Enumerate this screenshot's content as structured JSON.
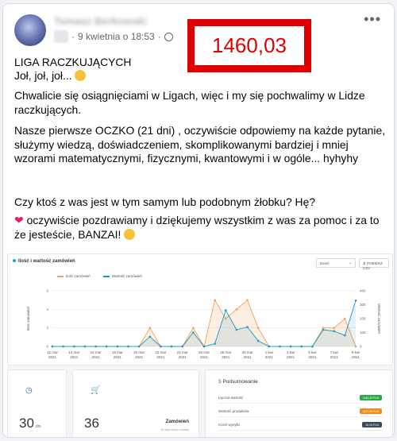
{
  "post": {
    "author": "Tomasz Berkowski",
    "timestamp": "9 kwietnia o 18:53",
    "more_label": "•••",
    "highlight_number": "1460,03",
    "title_line": "LIGA RACZKUJĄCYCH",
    "line2": "Joł, joł, joł...",
    "paragraph1": "Chwalicie się osiągnięciami w Ligach, więc i my się pochwalimy w Lidze raczkujących.",
    "paragraph2": "Nasze pierwsze OCZKO (21 dni) , oczywiście odpowiemy na każde pytanie, służymy wiedzą, doświadczeniem, skomplikowanymi bardziej i mniej wzorami matematycznymi, fizycznymi, kwantowymi i w ogóle... hyhyhy",
    "paragraph3": "Czy ktoś z was jest w tym samym lub podobnym żłobku? Hę?",
    "paragraph4": "oczywiście pozdrawiamy i dziękujemy wszystkim z was za pomoc i za to że jesteście, BANZAI!"
  },
  "dashboard": {
    "chart_title": "Ilość i wartość zamówień",
    "range_select": "Dzień",
    "download_label": "POBIERZ CSV",
    "legend": [
      "Ilość zamówień",
      "Wartość zamówień"
    ],
    "colors": {
      "orders": "#f0a35a",
      "value": "#1e98c8"
    },
    "stat1": {
      "value": "30",
      "unit": "dni"
    },
    "stat2": {
      "value": "36",
      "label": "Zamówień",
      "sub": "W wybranym czasie"
    },
    "summary": {
      "title": "Podsumowanie",
      "rows": [
        {
          "label": "Łączna wartość",
          "value": "1460,03 PLN",
          "color": "#2ba84a"
        },
        {
          "label": "Wartość produktów",
          "value": "1427,99 PLN",
          "color": "#f08b1e"
        },
        {
          "label": "Koszt wysyłki",
          "value": "32,04 PLN",
          "color": "#3b4a5a"
        }
      ]
    }
  },
  "chart_data": {
    "type": "area",
    "title": "Ilość i wartość zamówień",
    "ylabel": "Ilość zamówień",
    "y2label": "Wartość zamówień",
    "ylim": [
      0,
      6
    ],
    "y2lim": [
      0,
      400
    ],
    "x": [
      "12 mar 2021",
      "13 mar",
      "14 mar 2021",
      "15 mar",
      "16 mar 2021",
      "17 mar",
      "18 mar 2021",
      "19 mar",
      "20 mar 2021",
      "21 mar",
      "22 mar 2021",
      "23 mar",
      "24 mar 2021",
      "25 mar",
      "26 mar 2021",
      "27 mar",
      "28 mar 2021",
      "29 mar",
      "30 mar 2021",
      "31 mar",
      "1 kwi 2021",
      "2 kwi",
      "3 kwi 2021",
      "4 kwi",
      "5 kwi 2021",
      "6 kwi",
      "7 kwi 2021",
      "8 kwi",
      "9 kwi 2021"
    ],
    "tick_labels": [
      [
        "12 mar",
        "2021"
      ],
      [
        "14 mar",
        "2021"
      ],
      [
        "16 mar",
        "2021"
      ],
      [
        "18 mar",
        "2021"
      ],
      [
        "20 mar",
        "2021"
      ],
      [
        "22 mar",
        "2021"
      ],
      [
        "24 mar",
        "2021"
      ],
      [
        "26 mar",
        "2021"
      ],
      [
        "28 mar",
        "2021"
      ],
      [
        "30 mar",
        "2021"
      ],
      [
        "1 kwi",
        "2021"
      ],
      [
        "3 kwi",
        "2021"
      ],
      [
        "5 kwi",
        "2021"
      ],
      [
        "7 kwi",
        "2021"
      ],
      [
        "9 kwi",
        "2021"
      ]
    ],
    "series": [
      {
        "name": "Ilość zamówień",
        "axis": "left",
        "values": [
          0,
          0,
          0,
          0,
          0,
          0,
          0,
          0,
          0,
          2,
          0,
          0,
          0,
          2,
          0,
          5,
          3,
          4,
          5,
          2,
          0,
          0,
          0,
          0,
          0,
          2,
          2,
          3,
          0
        ]
      },
      {
        "name": "Wartość zamówień",
        "axis": "right",
        "values": [
          0,
          0,
          0,
          0,
          0,
          0,
          0,
          0,
          0,
          70,
          0,
          0,
          0,
          100,
          0,
          20,
          260,
          120,
          140,
          40,
          0,
          0,
          0,
          0,
          0,
          120,
          110,
          80,
          330
        ]
      }
    ]
  }
}
